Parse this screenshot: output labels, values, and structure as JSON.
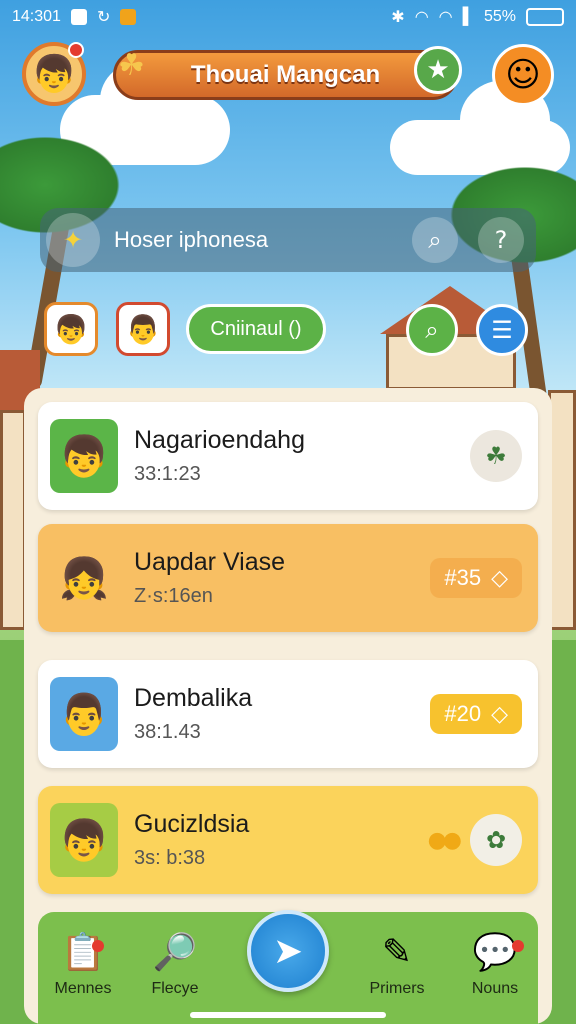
{
  "status_bar": {
    "time": "14:301",
    "battery": "55%"
  },
  "header": {
    "title": "Thouai Mangcan"
  },
  "search": {
    "placeholder": "Hoser iphonesa"
  },
  "filter": {
    "label": "Cniinaul ()"
  },
  "cards": [
    {
      "name": "Nagarioendahg",
      "sub": "33:1:23",
      "bg": "#ffffff",
      "avatar_bg": "#5bb548",
      "action_icon": "leaf-icon"
    },
    {
      "name": "Uapdar Viase",
      "sub": "Z·s:16en",
      "bg": "#f8bf63",
      "avatar_bg": "#f8bf63",
      "badge": "#35",
      "badge_bg": "#f4b55a"
    },
    {
      "name": "Dembalika",
      "sub": "38:1.43",
      "bg": "#ffffff",
      "avatar_bg": "#5aa9e4",
      "badge": "#20",
      "badge_bg": "#f7c22e"
    },
    {
      "name": "Gucizldsia",
      "sub": "3s: b:38",
      "bg": "#fbd35b",
      "avatar_bg": "#a6cc45",
      "action_icon": "plant-icon"
    }
  ],
  "nav": {
    "items": [
      {
        "label": "Mennes"
      },
      {
        "label": "Flecye"
      },
      {
        "label": "Primers"
      },
      {
        "label": "Nouns"
      }
    ]
  },
  "colors": {
    "accent_orange": "#e07a2c",
    "accent_green": "#5cb247",
    "fab_blue": "#1d7fcf"
  }
}
